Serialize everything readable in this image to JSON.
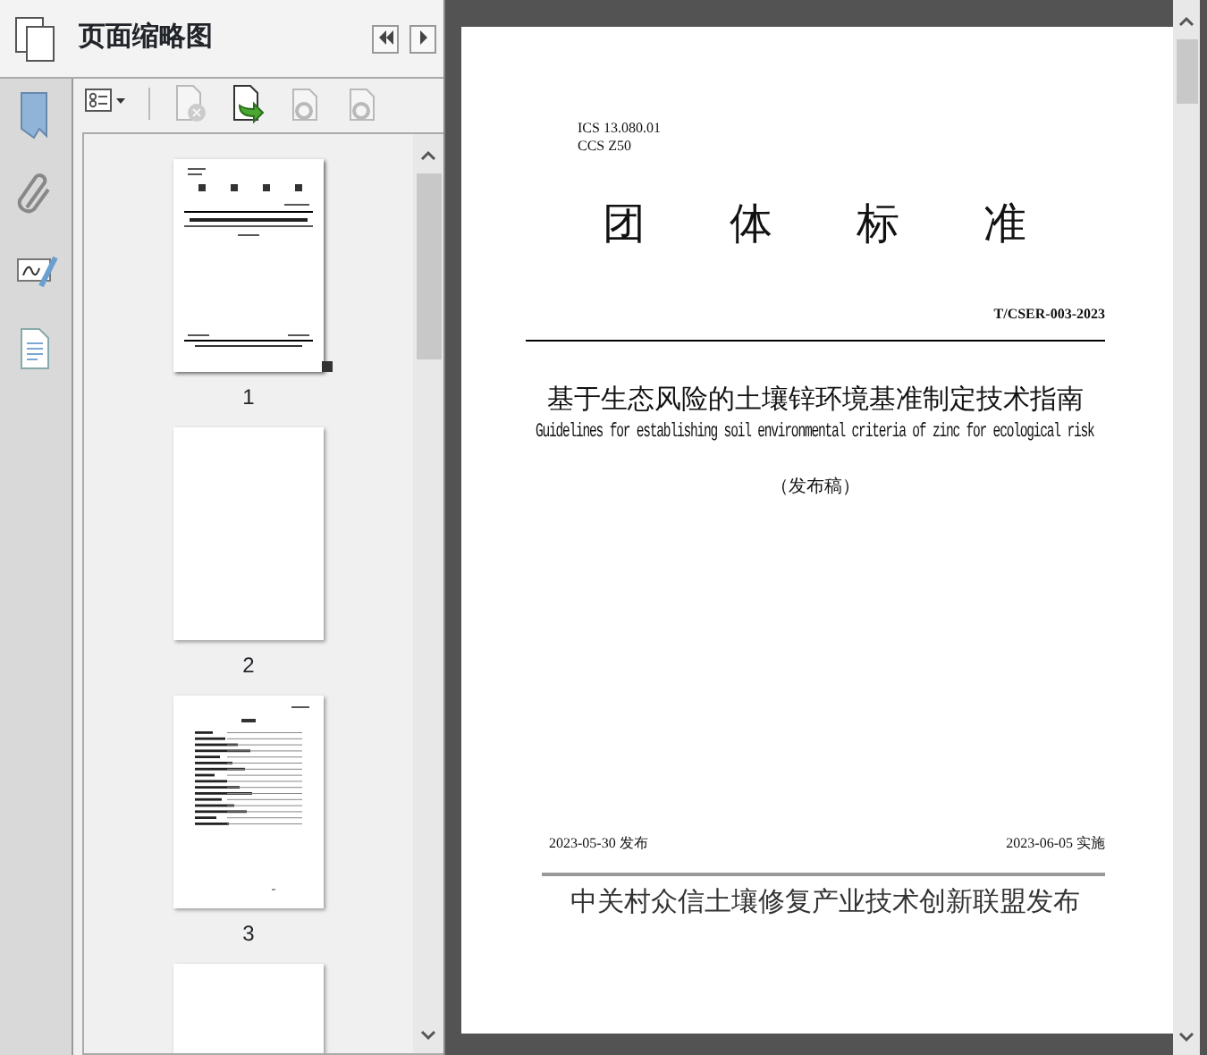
{
  "panel": {
    "title": "页面缩略图",
    "nav": [
      {
        "kind": "back"
      },
      {
        "kind": "forward"
      }
    ]
  },
  "rail": [
    {
      "kind": "bookmark"
    },
    {
      "kind": "attachment"
    },
    {
      "kind": "signature"
    },
    {
      "kind": "page"
    }
  ],
  "toolbar": [
    {
      "kind": "options",
      "disabled": false
    },
    {
      "kind": "delete",
      "disabled": true
    },
    {
      "kind": "insert",
      "disabled": false
    },
    {
      "kind": "extract",
      "disabled": true
    },
    {
      "kind": "replace",
      "disabled": true
    }
  ],
  "thumbnails": [
    {
      "label": "1",
      "selected": true,
      "kind": "cover"
    },
    {
      "label": "2",
      "selected": false,
      "kind": "blank"
    },
    {
      "label": "3",
      "selected": false,
      "kind": "contents"
    },
    {
      "kind": "blank",
      "selected": false
    }
  ],
  "page": {
    "ics": "ICS 13.080.01",
    "ccs": "CCS Z50",
    "heading": [
      "团",
      "体",
      "标",
      "准"
    ],
    "code": "T/CSER-003-2023",
    "title_cn": "基于生态风险的土壤锌环境基准制定技术指南",
    "title_en": "Guidelines for establishing soil environmental criteria of zinc for ecological risk",
    "status": "（发布稿）",
    "issued": "2023-05-30 发布",
    "implemented": "2023-06-05 实施",
    "publisher": "中关村众信土壤修复产业技术创新联盟发布"
  }
}
